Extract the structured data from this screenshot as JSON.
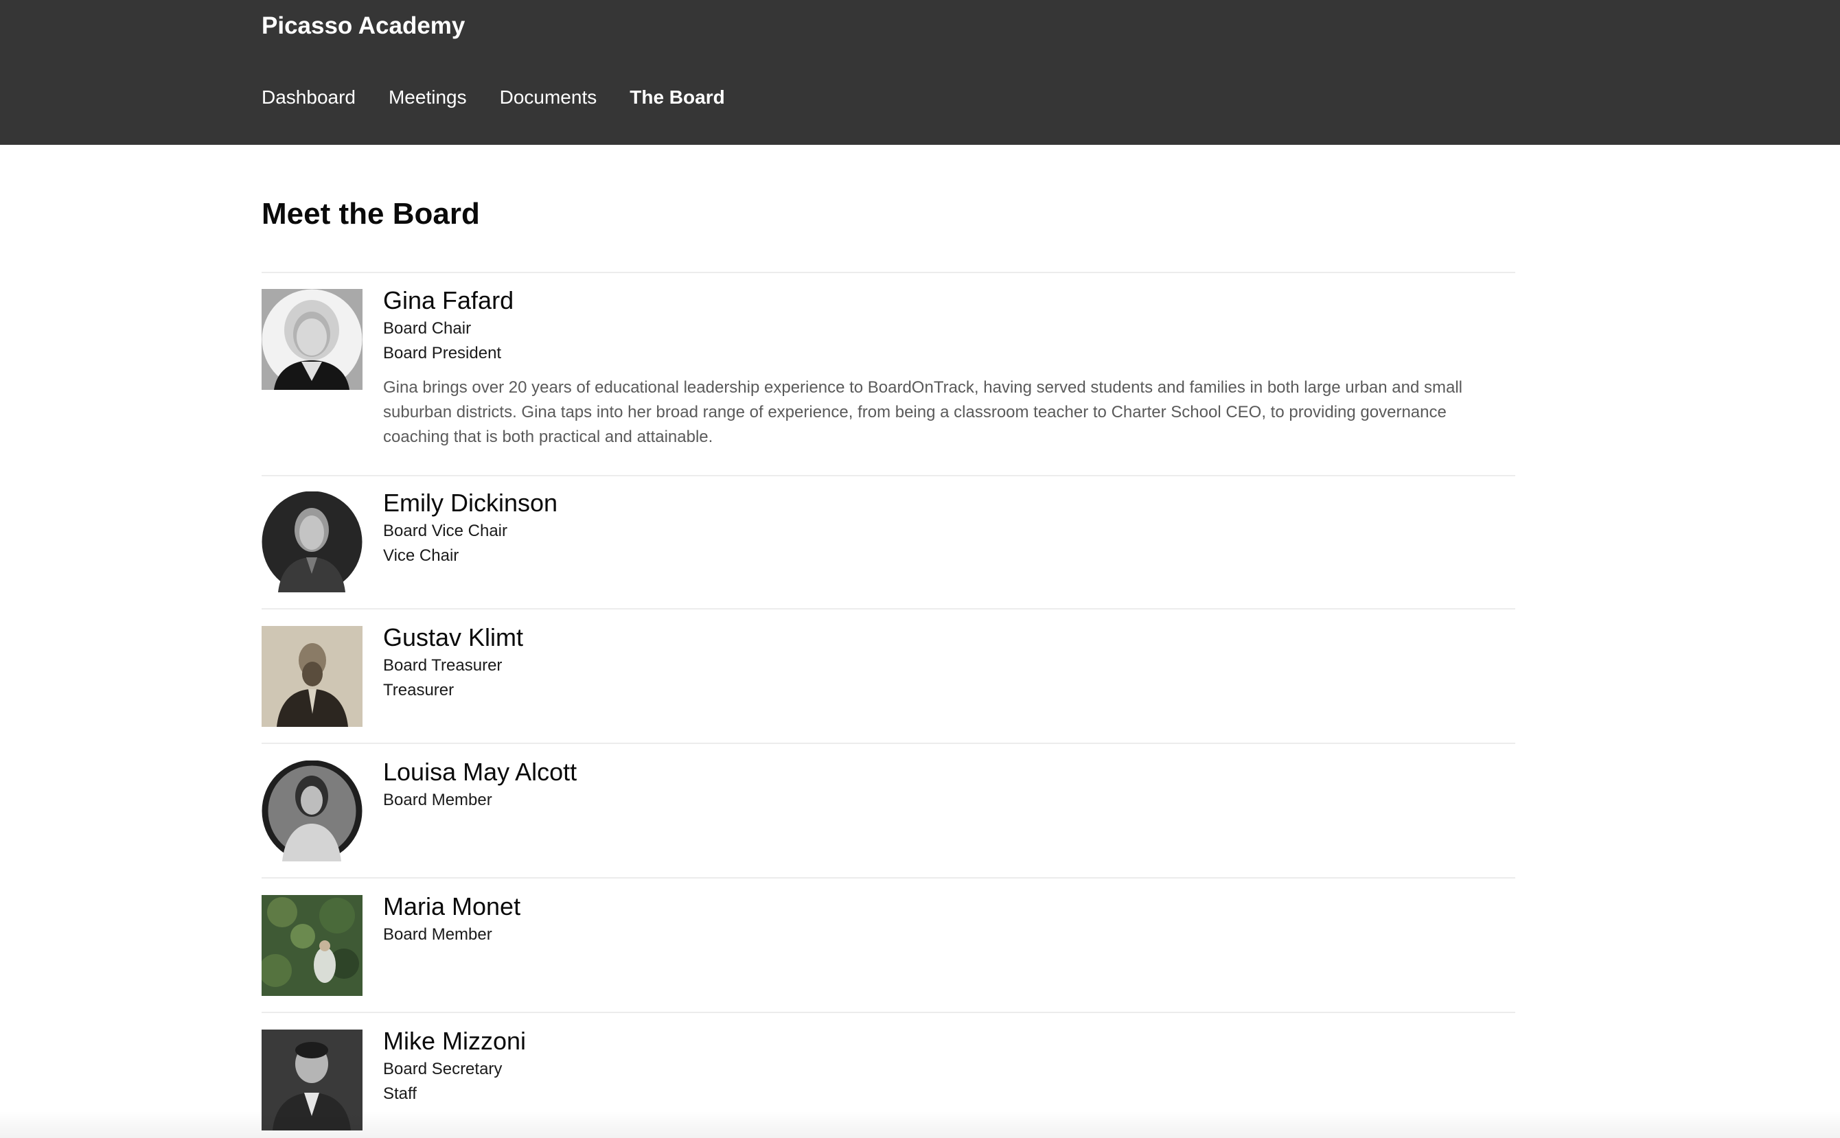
{
  "header": {
    "brand": "Picasso Academy",
    "nav": [
      {
        "label": "Dashboard",
        "active": false
      },
      {
        "label": "Meetings",
        "active": false
      },
      {
        "label": "Documents",
        "active": false
      },
      {
        "label": "The Board",
        "active": true
      }
    ]
  },
  "main": {
    "title": "Meet the Board",
    "members": [
      {
        "name": "Gina Fafard",
        "roles": [
          "Board Chair",
          "Board President"
        ],
        "bio": "Gina brings over 20 years of educational leadership experience to BoardOnTrack, having served students and families in both large urban and small suburban districts. Gina taps into her broad range of experience, from being a classroom teacher to Charter School CEO, to providing governance coaching that is both practical and attainable.",
        "photo": "portrait-photo"
      },
      {
        "name": "Emily Dickinson",
        "roles": [
          "Board Vice Chair",
          "Vice Chair"
        ],
        "bio": "",
        "photo": "oval-portrait-photo"
      },
      {
        "name": "Gustav Klimt",
        "roles": [
          "Board Treasurer",
          "Treasurer"
        ],
        "bio": "",
        "photo": "sepia-portrait-photo"
      },
      {
        "name": "Louisa May Alcott",
        "roles": [
          "Board Member"
        ],
        "bio": "",
        "photo": "oval-portrait-photo"
      },
      {
        "name": "Maria Monet",
        "roles": [
          "Board Member"
        ],
        "bio": "",
        "photo": "painting-photo"
      },
      {
        "name": "Mike Mizzoni",
        "roles": [
          "Board Secretary",
          "Staff"
        ],
        "bio": "",
        "photo": "portrait-photo"
      }
    ]
  },
  "colors": {
    "header_bg": "#363636",
    "header_text": "#ffffff",
    "divider": "#ececec",
    "bio_text": "#5a5a5a"
  }
}
